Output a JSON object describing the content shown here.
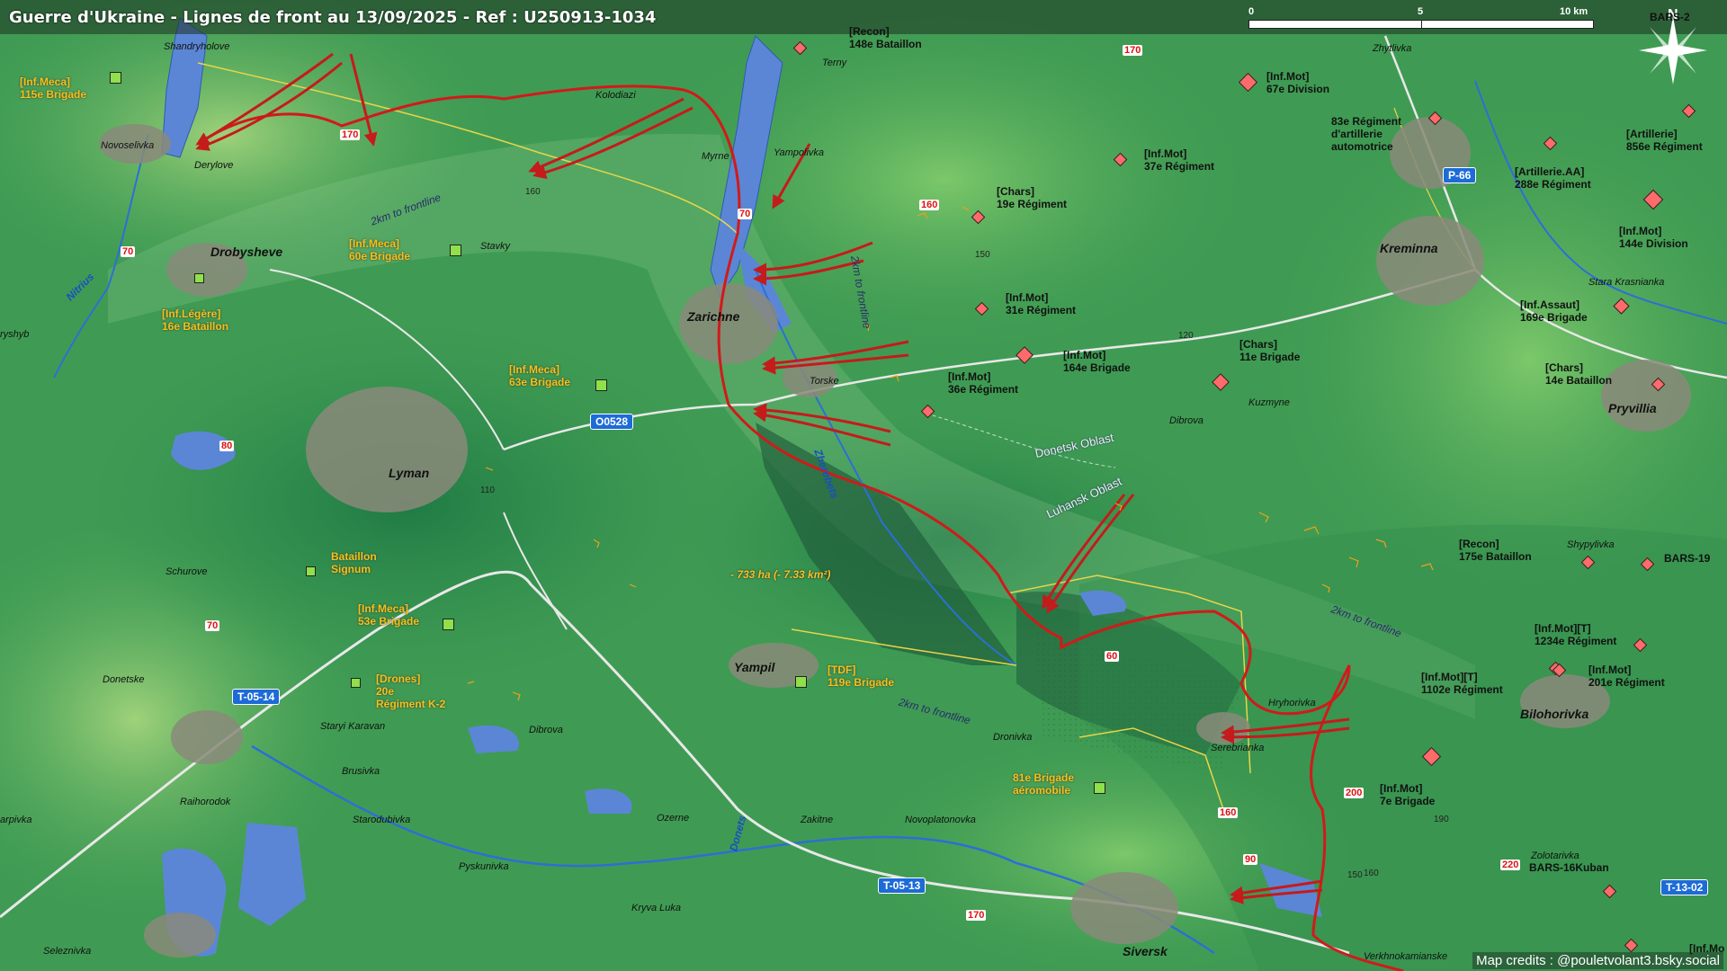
{
  "title": "Guerre d'Ukraine - Lignes de front au 13/09/2025 - Ref : U250913-1034",
  "credits": "Map credits : @pouletvolant3.bsky.social",
  "scale": {
    "t0": "0",
    "t5": "5",
    "t10": "10 km"
  },
  "compass": "N",
  "colors": {
    "frontline": "#d11a1a",
    "ru_unit": "#ff6a6a",
    "ua_unit": "#8fe04a",
    "road": "#1d6bd6",
    "water": "#5b86d6"
  },
  "towns": {
    "drobysheve": "Drobysheve",
    "lyman": "Lyman",
    "zarichne": "Zarichne",
    "yampil": "Yampil",
    "siversk": "Siversk",
    "kreminna": "Kreminna",
    "bilohorivka": "Bilohorivka",
    "pryvillia": "Pryvillia"
  },
  "villages": {
    "shandryholove": "Shandryholove",
    "novoselivka": "Novoselivka",
    "derylove": "Derylove",
    "kolodiazi": "Kolodiazi",
    "terny": "Terny",
    "myrne": "Myrne",
    "yampolivka": "Yampolivka",
    "stavky": "Stavky",
    "torske": "Torske",
    "dibrova_n": "Dibrova",
    "kuzmyne": "Kuzmyne",
    "zhytlivka": "Zhytlivka",
    "stara_krasnianka": "Stara Krasnianka",
    "shypylivka": "Shypylivka",
    "hryhorivka": "Hryhorivka",
    "serebrianka": "Serebrianka",
    "dronivka": "Dronivka",
    "novoplatonovka": "Novoplatonovka",
    "zakitne": "Zakitne",
    "ozerne": "Ozerne",
    "dibrova_s": "Dibrova",
    "staryi_karavan": "Staryi Karavan",
    "brusivka": "Brusivka",
    "raihorodok": "Raihorodok",
    "starodubivka": "Starodubivka",
    "pyskunivka": "Pyskunivka",
    "kryva_luka": "Kryva Luka",
    "seleznivka": "Seleznivka",
    "donetske": "Donetske",
    "schurove": "Schurove",
    "karpivka": "arpivka",
    "ryshyb": "ryshyb",
    "verkhnokamianske": "Verkhnokamianske",
    "zolotarivka": "Zolotarivka"
  },
  "rivers": {
    "nitrius": "Nitrius",
    "zherebets": "Zherebets",
    "donets": "Donets"
  },
  "zones": {
    "z1": "2km to frontline",
    "z2": "2km to frontline",
    "z3": "2km to frontline",
    "z4": "2km to frontline"
  },
  "oblasts": {
    "donetsk": "Donetsk Oblast",
    "luhansk": "Luhansk Oblast"
  },
  "area_label": "- 733 ha (- 7.33 km²)",
  "roads": {
    "o0528": "O0528",
    "t0514": "T-05-14",
    "t0513": "T-05-13",
    "p66": "P-66",
    "t1302": "T-13-02"
  },
  "route_numbers": {
    "r170a": "170",
    "r170b": "170",
    "r70a": "70",
    "r70b": "70",
    "r80": "80",
    "r160": "160",
    "r160b": "160",
    "r200": "200",
    "r90": "90",
    "r170c": "170",
    "r70c": "70",
    "r220": "220",
    "r60": "60"
  },
  "elevations": {
    "e160": "160",
    "e150": "150",
    "e120": "120",
    "e110": "110",
    "e190": "190",
    "e150b": "150",
    "e160b": "160"
  },
  "units_ua": {
    "u115": "[Inf.Meca]\n115e Brigade",
    "u60": "[Inf.Meca]\n60e Brigade",
    "u16": "[Inf.Légère]\n16e Bataillon",
    "u63": "[Inf.Meca]\n63e Brigade",
    "signum": "Bataillon\nSignum",
    "u53": "[Inf.Meca]\n53e Brigade",
    "drones": "[Drones]\n20e\nRégiment K-2",
    "tdf119": "[TDF]\n119e Brigade",
    "u81": "81e Brigade\naéromobile"
  },
  "units_ru": {
    "recon148": "[Recon]\n148e Bataillon",
    "mot67": "[Inf.Mot]\n67e Division",
    "art83": "83e Régiment\nd'artillerie\nautomotrice",
    "mot37": "[Inf.Mot]\n37e Régiment",
    "chars19": "[Chars]\n19e Régiment",
    "art856": "[Artillerie]\n856e Régiment",
    "aa288": "[Artillerie.AA]\n288e Régiment",
    "mot144": "[Inf.Mot]\n144e Division",
    "mot31": "[Inf.Mot]\n31e Régiment",
    "mot164": "[Inf.Mot]\n164e Brigade",
    "chars11": "[Chars]\n11e Brigade",
    "mot36": "[Inf.Mot]\n36e Régiment",
    "assault169": "[Inf.Assaut]\n169e Brigade",
    "chars14": "[Chars]\n14e Bataillon",
    "recon175": "[Recon]\n175e Bataillon",
    "bars19": "BARS-19",
    "mot1234": "[Inf.Mot][T]\n1234e Régiment",
    "mot1102": "[Inf.Mot][T]\n1102e Régiment",
    "mot201": "[Inf.Mot]\n201e Régiment",
    "mot7": "[Inf.Mot]\n7e Brigade",
    "bars16": "BARS-16Kuban",
    "bars2": "BARS-2",
    "infmo": "[Inf.Mo"
  }
}
